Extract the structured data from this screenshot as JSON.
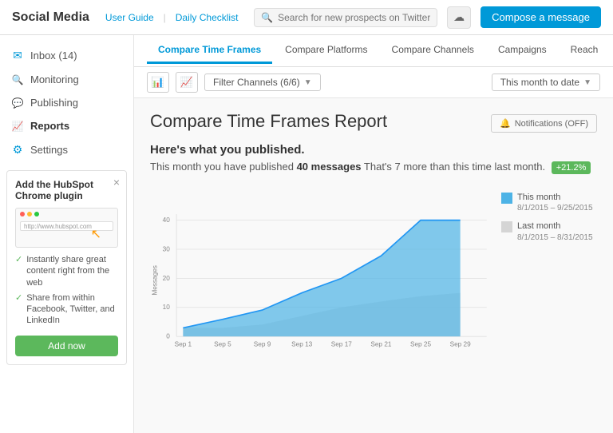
{
  "header": {
    "logo": "Social Media",
    "links": [
      {
        "label": "User Guide"
      },
      {
        "label": "Daily Checklist"
      }
    ],
    "search_placeholder": "Search for new prospects on Twitter",
    "compose_label": "Compose a message"
  },
  "sidebar": {
    "items": [
      {
        "id": "inbox",
        "label": "Inbox (14)",
        "icon": "✉"
      },
      {
        "id": "monitoring",
        "label": "Monitoring",
        "icon": "🔍"
      },
      {
        "id": "publishing",
        "label": "Publishing",
        "icon": "💬"
      },
      {
        "id": "reports",
        "label": "Reports",
        "icon": "📈",
        "active": true
      },
      {
        "id": "settings",
        "label": "Settings",
        "icon": "⚙"
      }
    ]
  },
  "plugin": {
    "title": "Add the HubSpot Chrome plugin",
    "browser_url": "http://www.hubspot.com",
    "features": [
      "Instantly share great content right from the web",
      "Share from within Facebook, Twitter, and LinkedIn"
    ],
    "add_label": "Add now"
  },
  "tabs": [
    {
      "id": "compare-time",
      "label": "Compare Time Frames",
      "active": true
    },
    {
      "id": "compare-platforms",
      "label": "Compare Platforms"
    },
    {
      "id": "compare-channels",
      "label": "Compare Channels"
    },
    {
      "id": "campaigns",
      "label": "Campaigns"
    },
    {
      "id": "reach",
      "label": "Reach"
    }
  ],
  "filter": {
    "channels_label": "Filter Channels (6/6)",
    "date_range_label": "This month to date"
  },
  "report": {
    "title": "Compare Time Frames Report",
    "notifications_label": "Notifications (OFF)",
    "published_title": "Here's what you published.",
    "published_desc_start": "This month you have published",
    "published_count": "40 messages",
    "published_desc_end": "That's 7 more than this time last month.",
    "badge": "+21.2%"
  },
  "chart": {
    "x_labels": [
      "Sep 1",
      "Sep 5",
      "Sep 9",
      "Sep 13",
      "Sep 17",
      "Sep 21",
      "Sep 25",
      "Sep 29"
    ],
    "y_labels": [
      "0",
      "10",
      "20",
      "30",
      "40"
    ],
    "y_axis_title": "Messages",
    "this_month_color": "#4db3e6",
    "last_month_color": "#d5d5d5",
    "legend": [
      {
        "label": "This month",
        "date": "8/1/2015 – 9/25/2015",
        "color": "#4db3e6"
      },
      {
        "label": "Last month",
        "date": "8/1/2015 – 8/31/2015",
        "color": "#d5d5d5"
      }
    ]
  }
}
